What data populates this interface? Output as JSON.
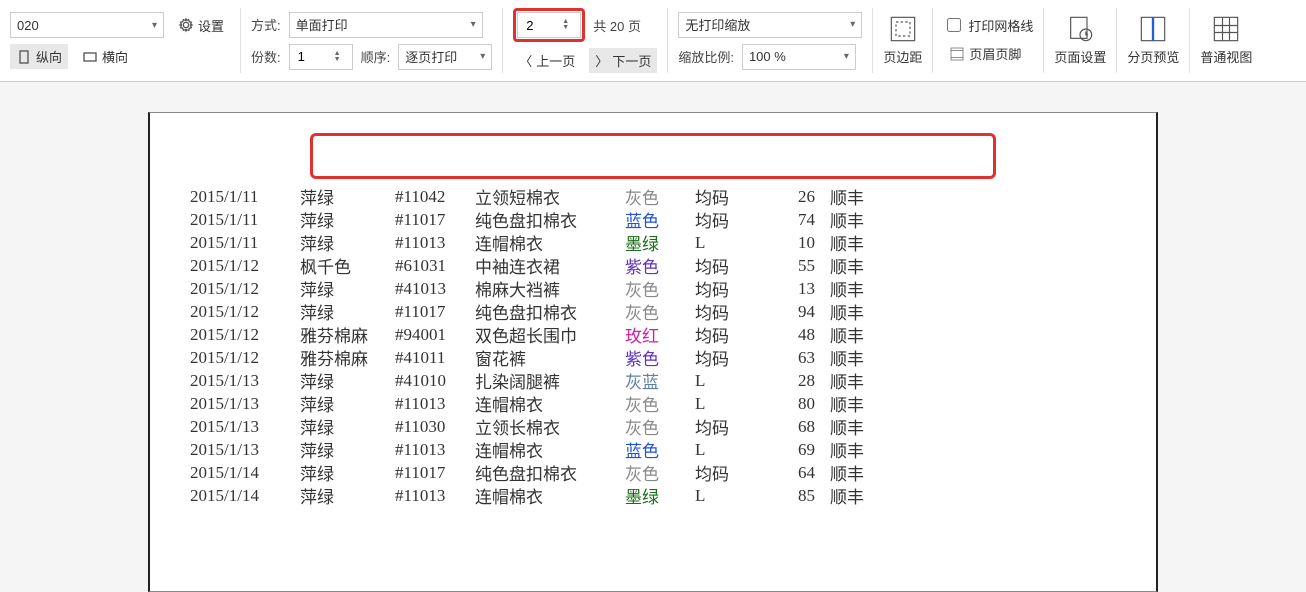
{
  "toolbar": {
    "printer_value": "020",
    "settings_label": "设置",
    "mode_label": "方式:",
    "mode_value": "单面打印",
    "copies_label": "份数:",
    "copies_value": "1",
    "order_label": "顺序:",
    "order_value": "逐页打印",
    "portrait_label": "纵向",
    "landscape_label": "横向",
    "current_page": "2",
    "total_pages_label": "共 20 页",
    "prev_label": "上一页",
    "next_label": "下一页",
    "scale_mode_value": "无打印缩放",
    "scale_ratio_label": "缩放比例:",
    "scale_ratio_value": "100 %",
    "margins_label": "页边距",
    "header_footer_label": "页眉页脚",
    "grid_label": "打印网格线",
    "page_setup_label": "页面设置",
    "pagebreak_label": "分页预览",
    "normal_label": "普通视图"
  },
  "rows": [
    {
      "d": "2015/1/11",
      "b": "萍绿",
      "c": "#11042",
      "p": "立领短棉衣",
      "col": "灰色",
      "cc": "col-gray",
      "s": "均码",
      "q": "26",
      "sh": "顺丰"
    },
    {
      "d": "2015/1/11",
      "b": "萍绿",
      "c": "#11017",
      "p": "纯色盘扣棉衣",
      "col": "蓝色",
      "cc": "col-blue",
      "s": "均码",
      "q": "74",
      "sh": "顺丰"
    },
    {
      "d": "2015/1/11",
      "b": "萍绿",
      "c": "#11013",
      "p": "连帽棉衣",
      "col": "墨绿",
      "cc": "col-darkgreen",
      "s": "L",
      "q": "10",
      "sh": "顺丰"
    },
    {
      "d": "2015/1/12",
      "b": "枫千色",
      "c": "#61031",
      "p": "中袖连衣裙",
      "col": "紫色",
      "cc": "col-purple",
      "s": "均码",
      "q": "55",
      "sh": "顺丰"
    },
    {
      "d": "2015/1/12",
      "b": "萍绿",
      "c": "#41013",
      "p": "棉麻大裆裤",
      "col": "灰色",
      "cc": "col-gray",
      "s": "均码",
      "q": "13",
      "sh": "顺丰"
    },
    {
      "d": "2015/1/12",
      "b": "萍绿",
      "c": "#11017",
      "p": "纯色盘扣棉衣",
      "col": "灰色",
      "cc": "col-gray",
      "s": "均码",
      "q": "94",
      "sh": "顺丰"
    },
    {
      "d": "2015/1/12",
      "b": "雅芬棉麻",
      "c": "#94001",
      "p": "双色超长围巾",
      "col": "玫红",
      "cc": "col-magenta",
      "s": "均码",
      "q": "48",
      "sh": "顺丰"
    },
    {
      "d": "2015/1/12",
      "b": "雅芬棉麻",
      "c": "#41011",
      "p": "窗花裤",
      "col": "紫色",
      "cc": "col-purple",
      "s": "均码",
      "q": "63",
      "sh": "顺丰"
    },
    {
      "d": "2015/1/13",
      "b": "萍绿",
      "c": "#41010",
      "p": "扎染阔腿裤",
      "col": "灰蓝",
      "cc": "col-graylblue",
      "s": "L",
      "q": "28",
      "sh": "顺丰"
    },
    {
      "d": "2015/1/13",
      "b": "萍绿",
      "c": "#11013",
      "p": "连帽棉衣",
      "col": "灰色",
      "cc": "col-gray",
      "s": "L",
      "q": "80",
      "sh": "顺丰"
    },
    {
      "d": "2015/1/13",
      "b": "萍绿",
      "c": "#11030",
      "p": "立领长棉衣",
      "col": "灰色",
      "cc": "col-gray",
      "s": "均码",
      "q": "68",
      "sh": "顺丰"
    },
    {
      "d": "2015/1/13",
      "b": "萍绿",
      "c": "#11013",
      "p": "连帽棉衣",
      "col": "蓝色",
      "cc": "col-blue",
      "s": "L",
      "q": "69",
      "sh": "顺丰"
    },
    {
      "d": "2015/1/14",
      "b": "萍绿",
      "c": "#11017",
      "p": "纯色盘扣棉衣",
      "col": "灰色",
      "cc": "col-gray",
      "s": "均码",
      "q": "64",
      "sh": "顺丰"
    },
    {
      "d": "2015/1/14",
      "b": "萍绿",
      "c": "#11013",
      "p": "连帽棉衣",
      "col": "墨绿",
      "cc": "col-darkgreen",
      "s": "L",
      "q": "85",
      "sh": "顺丰"
    }
  ]
}
